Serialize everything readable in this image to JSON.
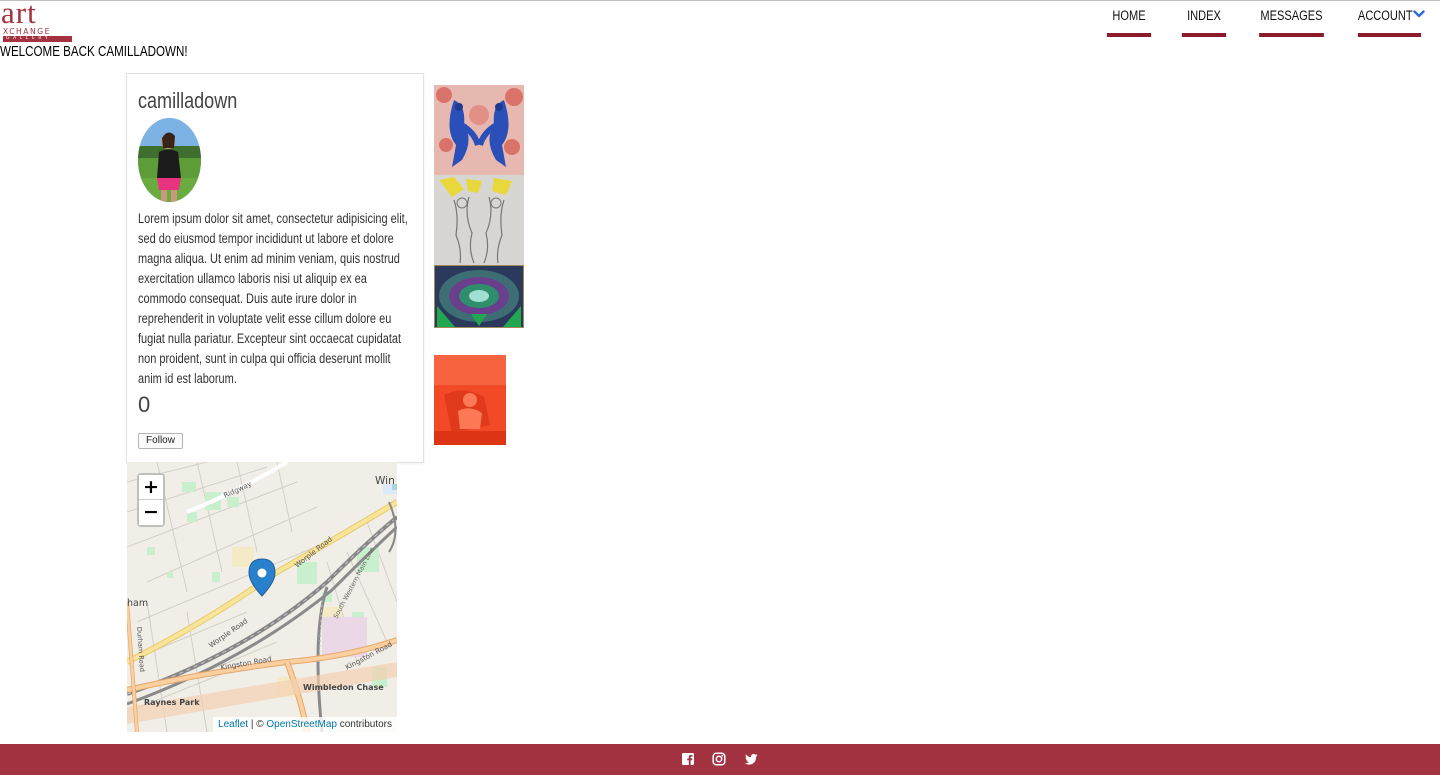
{
  "logo": {
    "art": "art",
    "xchange": "XCHANGE",
    "gallery": "GALLERY"
  },
  "nav": {
    "items": [
      {
        "label": "HOME"
      },
      {
        "label": "INDEX"
      },
      {
        "label": "MESSAGES"
      },
      {
        "label": "ACCOUNT"
      }
    ],
    "active_underline_color": "#8c1c2c"
  },
  "welcome": "WELCOME BACK CAMILLADOWN!",
  "profile": {
    "username": "camilladown",
    "bio": "Lorem ipsum dolor sit amet, consectetur adipisicing elit, sed do eiusmod tempor incididunt ut labore et dolore magna aliqua. Ut enim ad minim veniam, quis nostrud exercitation ullamco laboris nisi ut aliquip ex ea commodo consequat. Duis aute irure dolor in reprehenderit in voluptate velit esse cillum dolore eu fugiat nulla pariatur. Excepteur sint occaecat cupidatat non proident, sunt in culpa qui officia deserunt mollit anim id est laborum.",
    "followers": "0",
    "follow_label": "Follow"
  },
  "map": {
    "zoom_in": "+",
    "zoom_out": "−",
    "attribution": {
      "leaflet": "Leaflet",
      "separator": " | © ",
      "osm": "OpenStreetMap",
      "suffix": " contributors"
    },
    "labels": {
      "ridgway": "Ridgway",
      "worple_road_1": "Worple Road",
      "worple_road_2": "Worple Road",
      "main_line": "South Western Main Line",
      "kingston_road_1": "Kingston Road",
      "kingston_road_2": "Kingston Road",
      "wimbledon_chase": "Wimbledon Chase",
      "raynes_park": "Raynes Park",
      "durham_road": "Durham Road",
      "ham": "ham",
      "win": "Win"
    }
  },
  "footer": {
    "color": "#a43342",
    "icons": [
      "facebook-icon",
      "instagram-icon",
      "twitter-icon"
    ]
  },
  "colors": {
    "brand": "#a4313f",
    "accent_chevron": "#2a6fd6"
  }
}
